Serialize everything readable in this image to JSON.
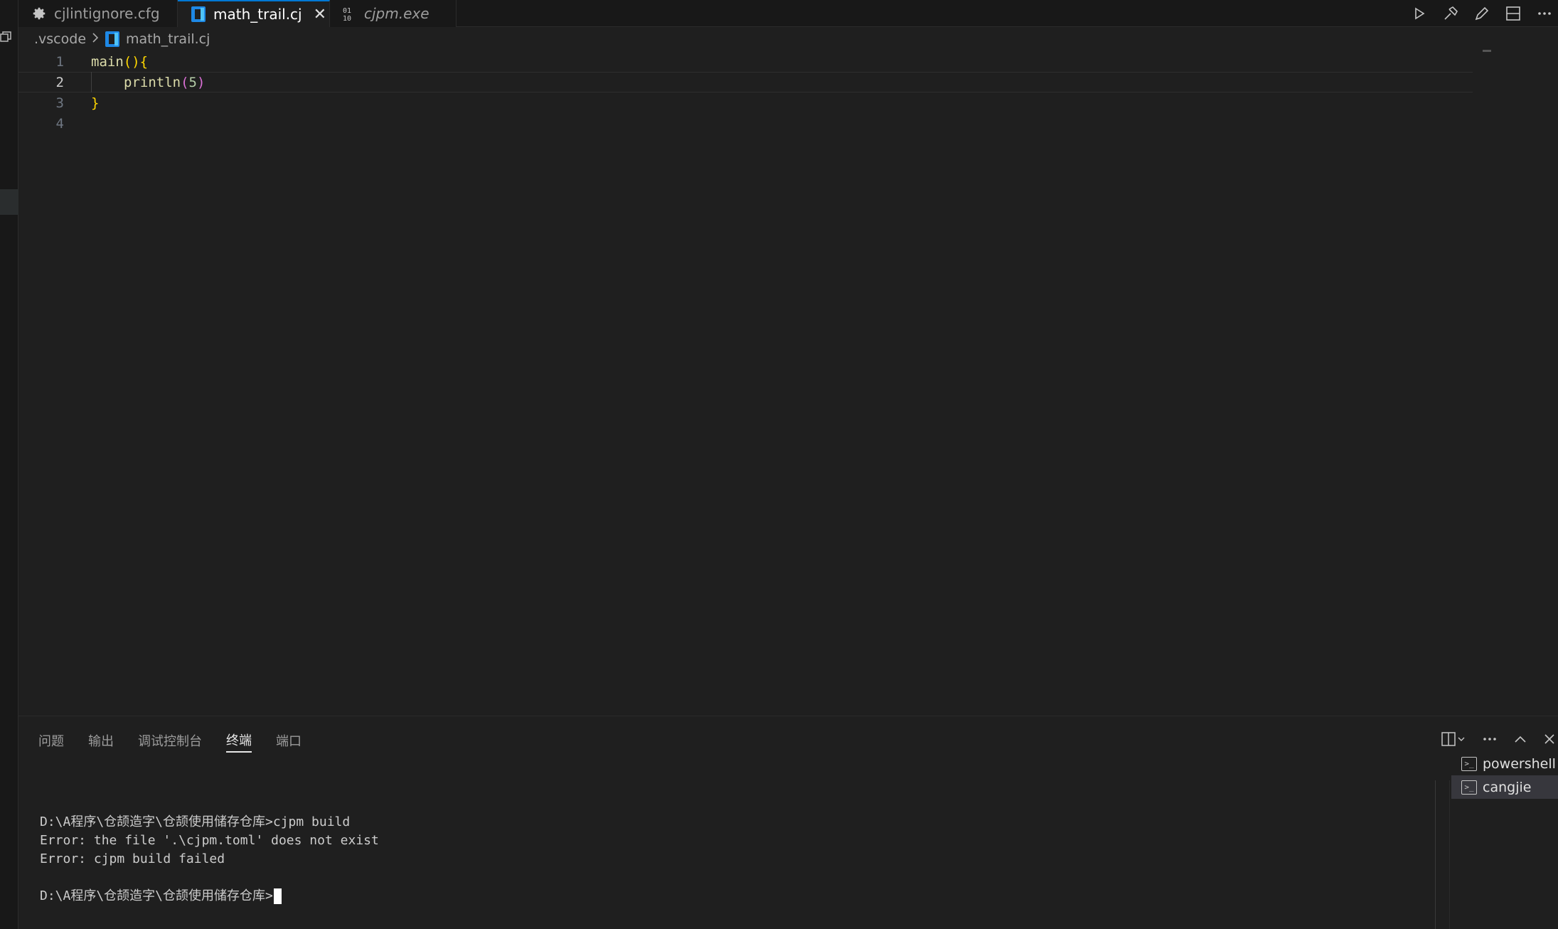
{
  "tabs": [
    {
      "label": "cjlintignore.cfg",
      "icon": "gear-icon",
      "active": false,
      "italic": false
    },
    {
      "label": "math_trail.cj",
      "icon": "cangjie-file-icon",
      "active": true,
      "italic": false,
      "close": "✕"
    },
    {
      "label": "cjpm.exe",
      "icon": "binary-file-icon",
      "active": false,
      "italic": true
    }
  ],
  "breadcrumb": {
    "folder": ".vscode",
    "file": "math_trail.cj"
  },
  "editor": {
    "line_numbers": [
      "1",
      "2",
      "3",
      "4"
    ],
    "current_line": 2,
    "lines": [
      {
        "fn": "main",
        "paren": "()",
        "brace": "{"
      },
      {
        "fn": "println",
        "open": "(",
        "num": "5",
        "close": ")"
      },
      {
        "brace": "}"
      },
      {}
    ]
  },
  "panel": {
    "tabs": [
      "问题",
      "输出",
      "调试控制台",
      "终端",
      "端口"
    ],
    "active_tab": "终端",
    "terminal_lines": [
      "",
      "D:\\A程序\\仓颉造字\\仓颉使用储存仓库>cjpm build",
      "Error: the file '.\\cjpm.toml' does not exist",
      "Error: cjpm build failed",
      "",
      "D:\\A程序\\仓颉造字\\仓颉使用储存仓库>"
    ],
    "terminals": [
      {
        "label": "powershell",
        "active": false
      },
      {
        "label": "cangjie",
        "active": true
      }
    ]
  },
  "colors": {
    "editor_bg": "#1f1f1f",
    "accent": "#0078d4",
    "function": "#dcdcaa",
    "brace": "#ffd700",
    "paren": "#da70d6"
  }
}
